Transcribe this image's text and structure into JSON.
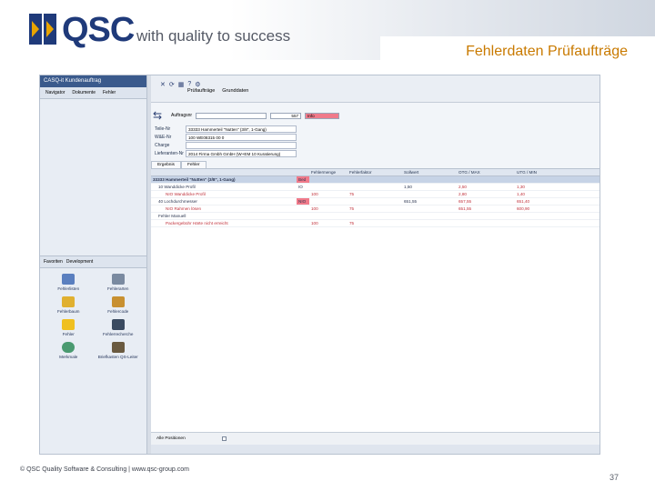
{
  "header": {
    "logo_text": "QSC",
    "tagline": "with quality to success",
    "slide_title": "Fehlerdaten Prüfaufträge"
  },
  "app": {
    "left_panel": {
      "title": "CASQ-it Kundenauftrag",
      "tabs": [
        "Navigator",
        "Dokumente",
        "Fehler"
      ],
      "lower_tabs": [
        "Favoriten",
        "Development"
      ],
      "icons": [
        {
          "label": "Fehlerlisten",
          "icon": "list-icon"
        },
        {
          "label": "Fehlerarten",
          "icon": "tools-icon"
        },
        {
          "label": "Fehlerbaum",
          "icon": "tree-icon"
        },
        {
          "label": "Fehlercode",
          "icon": "code-icon"
        },
        {
          "label": "Fehler",
          "icon": "lightning-icon"
        },
        {
          "label": "Fehlerrecherche",
          "icon": "search-icon"
        },
        {
          "label": "Merkmale",
          "icon": "globe-icon"
        },
        {
          "label": "Briefkasten QS-Leiter",
          "icon": "mailbox-icon"
        }
      ]
    },
    "toolbar": {
      "labels": [
        "Prüfaufträge",
        "Grunddaten"
      ],
      "search_label": "Auftragsnr",
      "search_value": "",
      "search_num": "557",
      "status_value": "Info"
    },
    "form": {
      "rows": [
        {
          "label": "Teile-Nr",
          "value": "33333 Hammerteil \"Nutten\" (3/8\", 1-Gang)"
        },
        {
          "label": "W&E-Nr",
          "value": "100 WE08315 00 0"
        },
        {
          "label": "Charge",
          "value": ""
        },
        {
          "label": "Lieferanten-Nr",
          "value": "2014 Firma Gmbh GmbH (W+EM 10 Kuratierung)"
        }
      ]
    },
    "detail_tabs": [
      "Ergebnis",
      "Fehler"
    ],
    "grid": {
      "headers": [
        "",
        "",
        "Fehlermenge",
        "Fehlerfaktor",
        "Sollwert",
        "OTG / MAX",
        "UTG / MIN"
      ],
      "rows": [
        {
          "name": "33333 Hammerteil \"Nutten\" (3/8\", 1-Gang)",
          "f": "Bed",
          "menge": "",
          "faktor": "",
          "soll": "",
          "otg": "",
          "utg": "",
          "sel": true
        },
        {
          "name": "10 Wanddicke Profil",
          "f": "IO",
          "menge": "",
          "faktor": "",
          "soll": "1,50",
          "otg": "2,50",
          "utg": "1,30",
          "sel": false
        },
        {
          "name": "NIO Wanddicke Profil",
          "f": "",
          "menge": "100",
          "faktor": "75",
          "soll": "",
          "otg": "2,80",
          "utg": "1,40",
          "sel": false
        },
        {
          "name": "40 Lochdurchmesser",
          "f": "NIO",
          "menge": "",
          "faktor": "",
          "soll": "651,55",
          "otg": "657,55",
          "utg": "651,40",
          "sel": false
        },
        {
          "name": "NIO Rahmen lösen",
          "f": "",
          "menge": "100",
          "faktor": "75",
          "soll": "",
          "otg": "651,55",
          "utg": "600,90",
          "sel": false
        },
        {
          "name": "Fehler Manuell",
          "f": "",
          "menge": "",
          "faktor": "",
          "soll": "",
          "otg": "",
          "utg": "",
          "sel": false
        },
        {
          "name": "Packergebühr Härte nicht erreicht",
          "f": "",
          "menge": "100",
          "faktor": "75",
          "soll": "",
          "otg": "",
          "utg": "",
          "sel": false
        }
      ]
    },
    "footer": {
      "label": "Alle Positionen"
    }
  },
  "footer": {
    "copyright": "© QSC Quality Software & Consulting | www.qsc-group.com",
    "page_number": "37"
  }
}
